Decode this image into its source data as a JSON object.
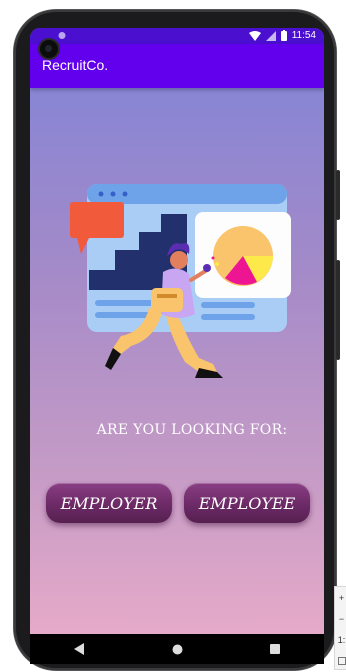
{
  "status_bar": {
    "time": "11:54"
  },
  "app_bar": {
    "title": "RecruitCo."
  },
  "main": {
    "question": "ARE YOU LOOKING FOR:",
    "employer_label": "EMPLOYER",
    "employee_label": "EMPLOYEE"
  },
  "emulator_toolbar": {
    "zoom_in": "+",
    "zoom_out": "−",
    "ratio": "1:"
  },
  "colors": {
    "status_bar": "#4b0fd0",
    "app_bar": "#6200ee",
    "button": "#6c2a66",
    "background_top": "#7f84d8",
    "background_bottom": "#e6aac9"
  },
  "icons": [
    "wifi-icon",
    "signal-icon",
    "battery-icon",
    "back-icon",
    "home-icon",
    "recents-icon"
  ]
}
